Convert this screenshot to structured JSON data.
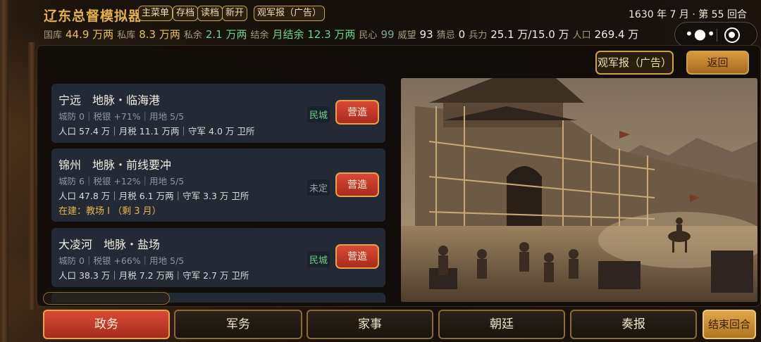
{
  "app": {
    "title": "辽东总督模拟器"
  },
  "top_buttons": {
    "main_menu": "主菜单",
    "save": "存档",
    "load": "读档",
    "new_game": "新开",
    "watch_ad": "观军报（广告）"
  },
  "date": {
    "text": "1630 年 7 月 · 第 55 回合"
  },
  "stats": {
    "guoku_label": "国库",
    "guoku_value": "44.9 万两",
    "siku_label": "私库",
    "siku_value": "8.3 万两",
    "siyu_label": "私余",
    "siyu_value": "2.1 万两",
    "jieyu_label": "结余",
    "jieyu_value": "月结余 12.3 万两",
    "minxin_label": "民心",
    "minxin_value": "99",
    "weiwang_label": "威望",
    "weiwang_value": "93",
    "cai_ji_label": "猜忌",
    "cai_ji_value": "0",
    "bingli_label": "兵力",
    "bingli_value": "25.1 万/15.0 万",
    "renkou_label": "人口",
    "renkou_value": "269.4 万"
  },
  "panel": {
    "ad_button": "观军报（广告）",
    "back_button": "返回"
  },
  "cities": [
    {
      "name": "宁远　地脉・临海港",
      "line1": "城防 0｜税银 +71%｜用地 5/5",
      "line2": "人口 57.4 万｜月税 11.1 万两｜守军 4.0 万 卫所",
      "tag": "民城",
      "action": "营造"
    },
    {
      "name": "锦州　地脉・前线要冲",
      "line1": "城防 6｜税银 +12%｜用地 5/5",
      "line2": "人口 47.8 万｜月税 6.1 万两｜守军 3.3 万 卫所",
      "building": "在建：教场 Ⅰ （剩 3 月）",
      "tag": "未定",
      "action": "营造"
    },
    {
      "name": "大凌河　地脉・盐场",
      "line1": "城防 0｜税银 +66%｜用地 5/5",
      "line2": "人口 38.3 万｜月税 7.2 万两｜守军 2.7 万 卫所",
      "tag": "民城",
      "action": "营造"
    }
  ],
  "tabs": {
    "politics": "政务",
    "military": "军务",
    "family": "家事",
    "court": "朝廷",
    "memorial": "奏报",
    "end_turn": "结束回合"
  },
  "colors": {
    "accent_gold": "#c9a24e",
    "active_red": "#d94a36",
    "value_yellow": "#e8c15a",
    "value_green": "#6fd08a"
  }
}
